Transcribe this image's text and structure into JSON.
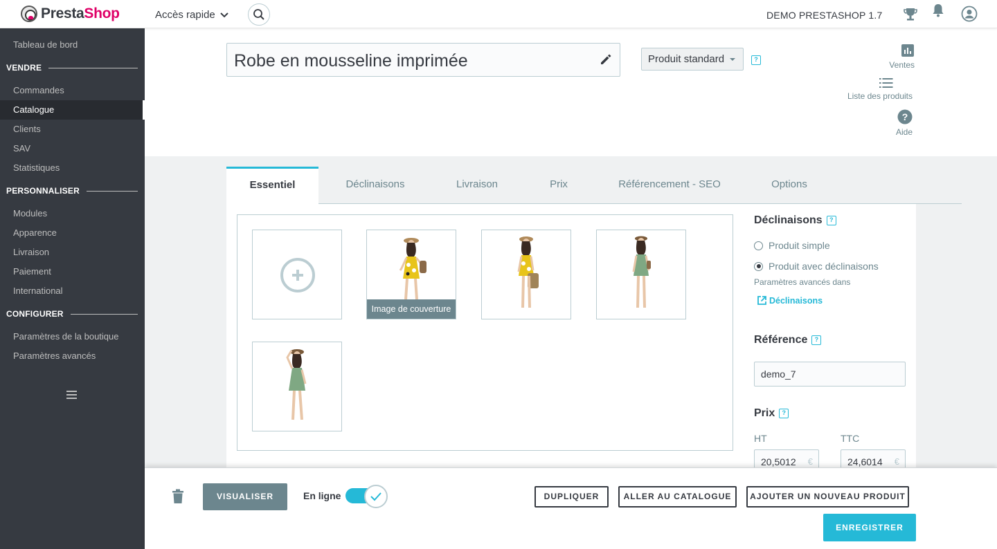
{
  "header": {
    "logo": "PrestaShop",
    "quick_access": "Accès rapide",
    "shop_name": "DEMO PRESTASHOP 1.7",
    "icons": [
      "search-icon",
      "trophy-icon",
      "bell-icon",
      "account-icon"
    ]
  },
  "sidebar": {
    "dashboard": "Tableau de bord",
    "sections": [
      {
        "title": "VENDRE",
        "items": [
          "Commandes",
          "Catalogue",
          "Clients",
          "SAV",
          "Statistiques"
        ]
      },
      {
        "title": "PERSONNALISER",
        "items": [
          "Modules",
          "Apparence",
          "Livraison",
          "Paiement",
          "International"
        ]
      },
      {
        "title": "CONFIGURER",
        "items": [
          "Paramètres de la boutique",
          "Paramètres avancés"
        ]
      }
    ],
    "active_item": "Catalogue"
  },
  "product": {
    "name": "Robe en mousseline imprimée",
    "type": "Produit standard"
  },
  "header_actions": {
    "sales": "Ventes",
    "product_list": "Liste des produits",
    "help": "Aide"
  },
  "tabs": [
    "Essentiel",
    "Déclinaisons",
    "Livraison",
    "Prix",
    "Référencement - SEO",
    "Options"
  ],
  "active_tab": "Essentiel",
  "images": {
    "cover_label": "Image de couverture",
    "count": 4
  },
  "combinations": {
    "title": "Déclinaisons",
    "option_simple": "Produit simple",
    "option_combinations": "Produit avec déclinaisons",
    "selected": "Produit avec déclinaisons",
    "advanced_note": "Paramètres avancés dans",
    "advanced_link": "Déclinaisons"
  },
  "reference": {
    "title": "Référence",
    "value": "demo_7"
  },
  "price": {
    "title": "Prix",
    "ht_label": "HT",
    "ttc_label": "TTC",
    "ht_value": "20,5012",
    "ttc_value": "24,6014",
    "currency": "€"
  },
  "footer": {
    "preview": "VISUALISER",
    "online_label": "En ligne",
    "online": true,
    "duplicate": "DUPLIQUER",
    "go_catalog": "ALLER AU CATALOGUE",
    "add_new": "AJOUTER UN NOUVEAU PRODUIT",
    "save": "ENREGISTRER"
  },
  "colors": {
    "accent": "#25b9d7",
    "sidebar_bg": "#363a41",
    "brand": "#df0067",
    "muted": "#6c868e"
  }
}
